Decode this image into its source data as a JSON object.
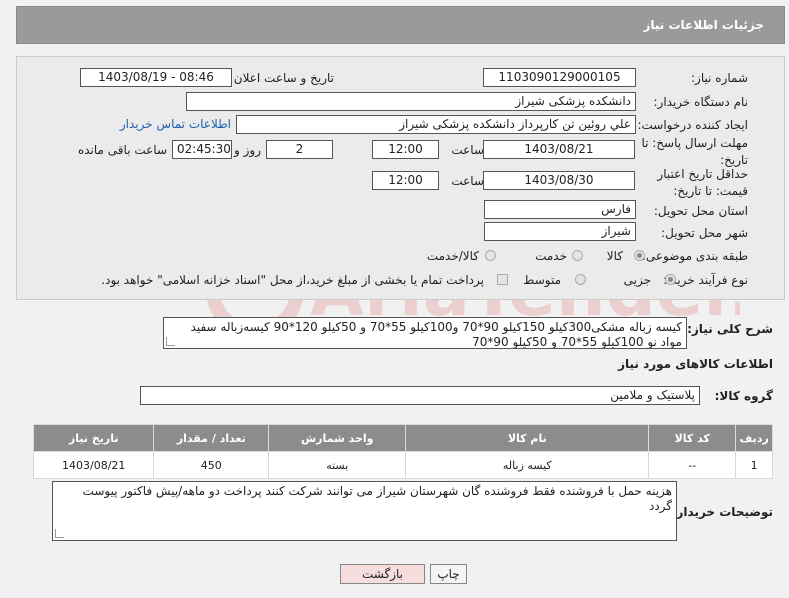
{
  "header": {
    "title": "جزئیات اطلاعات نیاز"
  },
  "form": {
    "need_number_label": "شماره نیاز:",
    "need_number": "1103090129000105",
    "announce_label": "تاریخ و ساعت اعلان عمومی:",
    "announce_value": "1403/08/19 - 08:46",
    "buyer_org_label": "نام دستگاه خریدار:",
    "buyer_org": "دانشکده پزشکی شیراز",
    "requester_label": "ایجاد کننده درخواست:",
    "requester": "علي روئين تن كارپرداز دانشکده پزشکی شیراز",
    "contact_link": "اطلاعات تماس خریدار",
    "deadline_label": "مهلت ارسال پاسخ: تا تاریخ:",
    "deadline_date": "1403/08/21",
    "time_label": "ساعت",
    "deadline_time": "12:00",
    "days_value": "2",
    "days_label": "روز و",
    "remaining_time": "02:45:30",
    "remaining_label": "ساعت باقی مانده",
    "validity_label": "حداقل تاریخ اعتبار قیمت: تا تاریخ:",
    "validity_date": "1403/08/30",
    "validity_time": "12:00",
    "province_label": "استان محل تحویل:",
    "province": "فارس",
    "city_label": "شهر محل تحویل:",
    "city": "شیراز",
    "category_label": "طبقه بندی موضوعی:",
    "category_options": [
      "کالا",
      "خدمت",
      "کالا/خدمت"
    ],
    "purchase_type_label": "نوع فرآیند خرید :",
    "purchase_options": [
      "جزیی",
      "متوسط"
    ],
    "payment_note": "پرداخت تمام یا بخشی از مبلغ خرید،از محل \"اسناد خزانه اسلامی\" خواهد بود."
  },
  "summary": {
    "label": "شرح کلی نیاز:",
    "text": "کیسه زباله مشکی300کیلو 150کیلو 90*70 و100کیلو 55*70 و 50کیلو 120*90 کیسه‌زباله سفید مواد نو 100کیلو 55*70 و 50کیلو 90*70"
  },
  "goods_section": {
    "title": "اطلاعات کالاهای مورد نیاز",
    "group_label": "گروه کالا:",
    "group_value": "پلاستیک و ملامین"
  },
  "table": {
    "headers": [
      "ردیف",
      "کد کالا",
      "نام کالا",
      "واحد شمارش",
      "تعداد / مقدار",
      "تاریخ نیاز"
    ],
    "rows": [
      [
        "1",
        "--",
        "کیسه زباله",
        "بسته",
        "450",
        "1403/08/21"
      ]
    ]
  },
  "buyer_notes": {
    "label": "توضیحات خریدار:",
    "text": "هزینه حمل با فروشنده فقط فروشنده گان شهرستان شیراز می توانند شرکت کنند پرداخت دو ماهه/پیش فاکتور پیوست گردد"
  },
  "buttons": {
    "print": "چاپ",
    "back": "بازگشت"
  },
  "watermark_text": "AriaTender.neT",
  "colors": {
    "header_bg": "#9a9a9a",
    "table_header_bg": "#8c8c8c",
    "link": "#1f5fb0",
    "back_button_bg": "#f7dede"
  }
}
